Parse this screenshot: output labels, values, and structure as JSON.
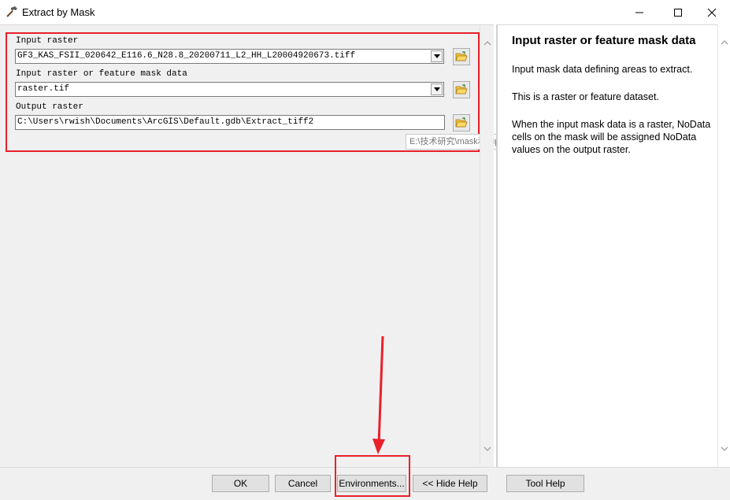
{
  "window": {
    "title": "Extract by Mask",
    "controls": {
      "minimize": "minimize-icon",
      "maximize": "maximize-icon",
      "close": "close-icon"
    }
  },
  "form": {
    "input_raster": {
      "label": "Input raster",
      "value": "GF3_KAS_FSII_020642_E116.6_N28.8_20200711_L2_HH_L20004920673.tiff"
    },
    "mask_data": {
      "label": "Input raster or feature mask data",
      "value": "raster.tif"
    },
    "output_raster": {
      "label": "Output raster",
      "value": "C:\\Users\\rwish\\Documents\\ArcGIS\\Default.gdb\\Extract_tiff2"
    },
    "tooltip": "E:\\技术研究\\mask和clip"
  },
  "help": {
    "title": "Input raster or feature mask data",
    "paragraphs": [
      "Input mask data defining areas to extract.",
      "This is a raster or feature dataset.",
      "When the input mask data is a raster, NoData cells on the mask will be assigned NoData values on the output raster."
    ]
  },
  "buttons": {
    "ok": "OK",
    "cancel": "Cancel",
    "environments": "Environments...",
    "hide_help": "<< Hide Help",
    "tool_help": "Tool Help"
  },
  "colors": {
    "annotation_red": "#e8202a",
    "dialog_bg": "#f0f0f0",
    "folder_yellow": "#f5c542"
  }
}
